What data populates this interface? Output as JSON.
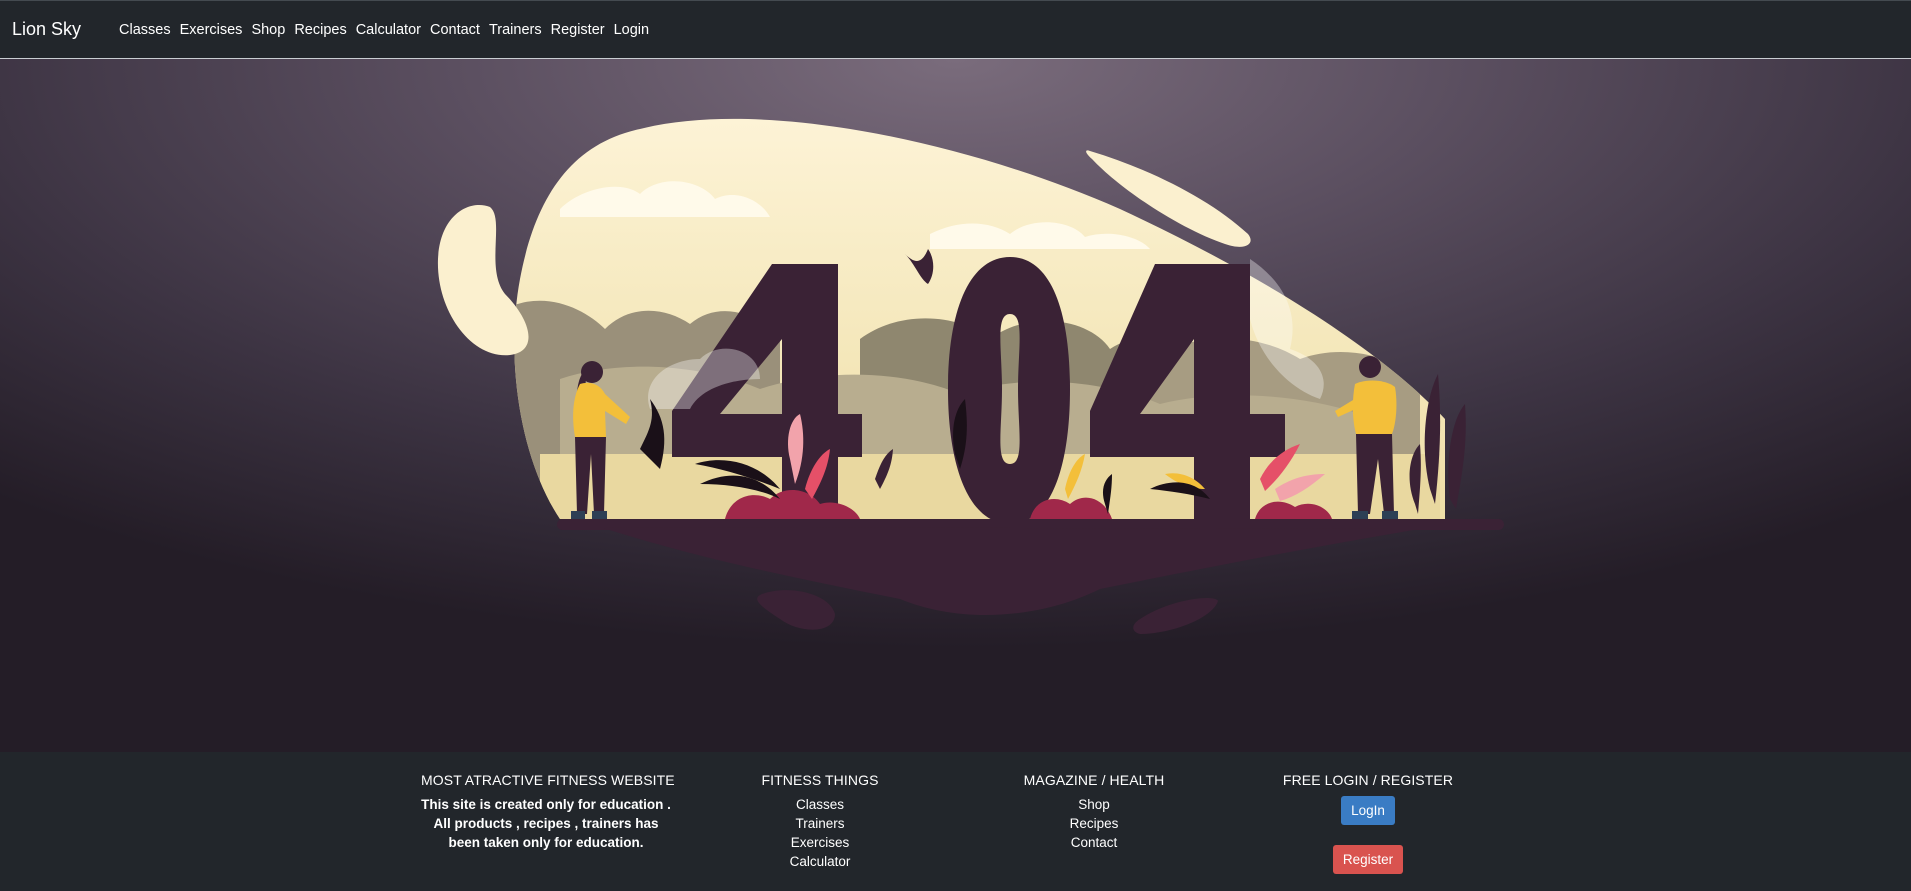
{
  "nav": {
    "brand": "Lion Sky",
    "links": [
      "Classes",
      "Exercises",
      "Shop",
      "Recipes",
      "Calculator",
      "Contact",
      "Trainers",
      "Register",
      "Login"
    ]
  },
  "hero": {
    "error_code": "404",
    "colors": {
      "dark": "#3a2235",
      "cream": "#fbf0cf",
      "accent_yellow": "#f3bf3a",
      "accent_pink": "#e8697b"
    }
  },
  "footer": {
    "col1": {
      "title": "MOST ATRACTIVE FITNESS WEBSITE",
      "text": "This site is created only for education . All products , recipes , trainers has been taken only for education."
    },
    "col2": {
      "title": "FITNESS THINGS",
      "links": [
        "Classes",
        "Trainers",
        "Exercises",
        "Calculator"
      ]
    },
    "col3": {
      "title": "MAGAZINE / HEALTH",
      "links": [
        "Shop",
        "Recipes",
        "Contact"
      ]
    },
    "col4": {
      "title": "FREE LOGIN / REGISTER",
      "login_label": "LogIn",
      "register_label": "Register"
    }
  }
}
